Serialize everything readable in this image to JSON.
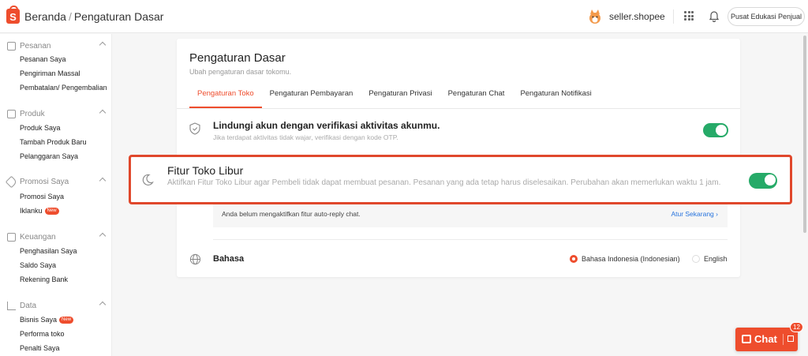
{
  "header": {
    "home": "Beranda",
    "separator": "/",
    "current": "Pengaturan Dasar",
    "shop_name": "seller.shopee",
    "edu_button": "Pusat Edukasi Penjual"
  },
  "sidebar": {
    "sections": [
      {
        "title": "Pesanan",
        "items": [
          "Pesanan Saya",
          "Pengiriman Massal",
          "Pembatalan/ Pengembalian"
        ]
      },
      {
        "title": "Produk",
        "items": [
          "Produk Saya",
          "Tambah Produk Baru",
          "Pelanggaran Saya"
        ]
      },
      {
        "title": "Promosi Saya",
        "items": [
          "Promosi Saya",
          "Iklanku"
        ]
      },
      {
        "title": "Keuangan",
        "items": [
          "Penghasilan Saya",
          "Saldo Saya",
          "Rekening Bank"
        ]
      },
      {
        "title": "Data",
        "items": [
          "Bisnis Saya",
          "Performa toko",
          "Penalti Saya"
        ]
      }
    ],
    "new_badge": "New"
  },
  "page": {
    "title": "Pengaturan Dasar",
    "subtitle": "Ubah pengaturan dasar tokomu.",
    "tabs": [
      "Pengaturan Toko",
      "Pengaturan Pembayaran",
      "Pengaturan Privasi",
      "Pengaturan Chat",
      "Pengaturan Notifikasi"
    ]
  },
  "settings": {
    "verify": {
      "title": "Lindungi akun dengan verifikasi aktivitas akunmu.",
      "desc": "Jika terdapat aktivitas tidak wajar, verifikasi dengan kode OTP.",
      "enabled": true
    },
    "holiday": {
      "title": "Fitur Toko Libur",
      "desc": "Aktifkan Fitur Toko Libur agar Pembeli tidak dapat membuat pesanan. Pesanan yang ada tetap harus diselesaikan. Perubahan akan memerlukan waktu 1 jam.",
      "enabled": true
    },
    "autoreply": {
      "text": "Anda belum mengaktifkan fitur auto-reply chat.",
      "link": "Atur Sekarang"
    },
    "language": {
      "title": "Bahasa",
      "options": [
        "Bahasa Indonesia (Indonesian)",
        "English"
      ],
      "selected": "Bahasa Indonesia (Indonesian)"
    }
  },
  "chat": {
    "label": "Chat",
    "unread": "12"
  },
  "colors": {
    "brand": "#ee4d2d",
    "toggle_on": "#26aa68",
    "link": "#2673dd",
    "highlight_border": "#e0482c"
  }
}
